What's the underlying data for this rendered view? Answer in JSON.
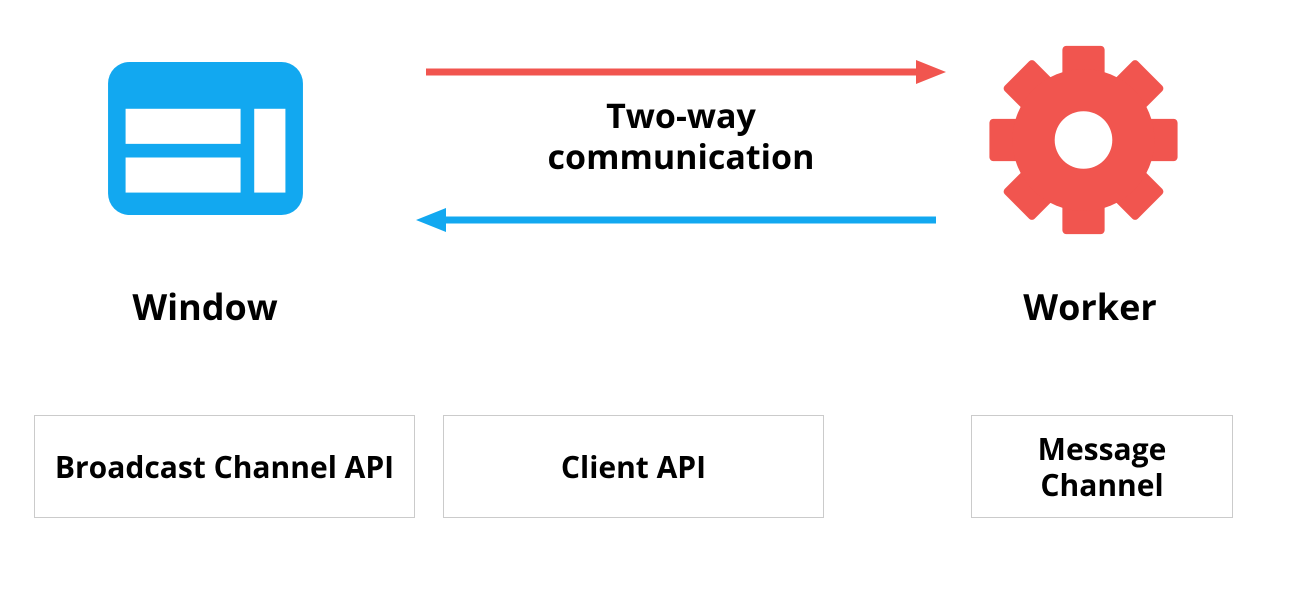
{
  "labels": {
    "window": "Window",
    "worker": "Worker",
    "comm_line1": "Two-way",
    "comm_line2": "communication"
  },
  "apiBoxes": {
    "broadcast": "Broadcast Channel API",
    "client": "Client API",
    "message": "Message Channel"
  },
  "colors": {
    "blue": "#12a8f0",
    "red": "#f1554f",
    "border": "#cbcbcb"
  }
}
